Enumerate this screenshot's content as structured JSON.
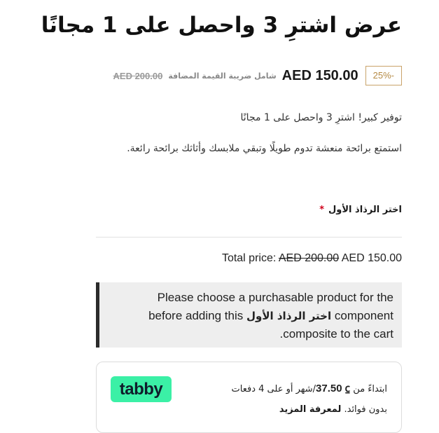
{
  "product": {
    "title": "عرض اشترِ 3 واحصل على 1 مجانًا"
  },
  "pricing": {
    "discount_badge": "-25%",
    "sale_price": "AED 150.00",
    "tax_note": "شامل ضريبة القيمة المضافة",
    "original_price": "AED 200.00"
  },
  "description": {
    "line1": "توفير كبير! اشترِ 3 واحصل على 1 مجانًا",
    "line2": "استمتع برائحة منعشة تدوم طويلًا وتبقي ملابسك وأثاثك برائحة رائعة."
  },
  "component": {
    "label": "اختر الرذاذ الأول",
    "required_mark": "*"
  },
  "total": {
    "label": "Total price:",
    "original": "AED 200.00",
    "current": "AED 150.00"
  },
  "notice": {
    "line1": "Please choose a purchasable product for the",
    "line2_pre": "component",
    "line2_bold": "اختر الرذاذ الأول",
    "line2_post": "before adding this",
    "line3": "composite to the cart."
  },
  "tabby": {
    "logo_text": "tabby",
    "prefix": "ابتداءً من",
    "amount": "37.50 ⃀",
    "suffix": "/شهر أو على 4 دفعات",
    "line2": "بدون فوائد.",
    "learn_more": "لمعرفة المزيد",
    "brand_color": "#3bf0a6"
  }
}
